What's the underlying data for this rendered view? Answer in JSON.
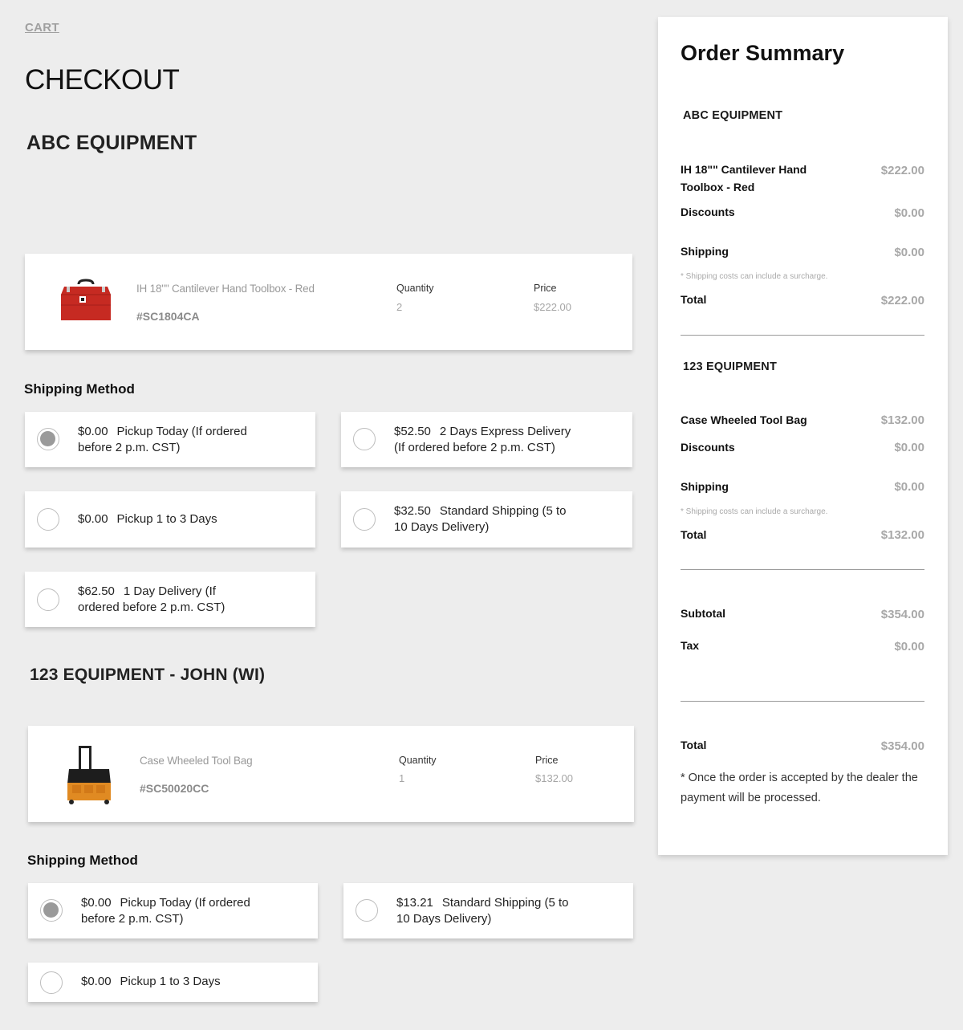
{
  "breadcrumb": {
    "cart_label": "CART"
  },
  "page_title": "CHECKOUT",
  "dealers": [
    {
      "name": "ABC EQUIPMENT",
      "product": {
        "name": "IH 18\"\" Cantilever Hand Toolbox - Red",
        "sku": "#SC1804CA",
        "quantity_label": "Quantity",
        "quantity": "2",
        "price_label": "Price",
        "price": "$222.00",
        "image": "red-toolbox-image"
      },
      "shipping_heading": "Shipping Method",
      "shipping_options": [
        {
          "price": "$0.00",
          "line1": "Pickup Today (If ordered",
          "line2": "before 2 p.m. CST)",
          "selected": true
        },
        {
          "price": "$52.50",
          "line1": "2 Days Express Delivery",
          "line2": "(If ordered before 2 p.m. CST)",
          "selected": false
        },
        {
          "price": "$0.00",
          "line1": "Pickup 1 to 3 Days",
          "line2": "",
          "selected": false
        },
        {
          "price": "$32.50",
          "line1": "Standard Shipping (5 to",
          "line2": "10 Days Delivery)",
          "selected": false
        },
        {
          "price": "$62.50",
          "line1": "1 Day Delivery (If",
          "line2": "ordered before 2 p.m. CST)",
          "selected": false
        }
      ]
    },
    {
      "name": "123 EQUIPMENT - JOHN (WI)",
      "product": {
        "name": "Case Wheeled Tool Bag",
        "sku": "#SC50020CC",
        "quantity_label": "Quantity",
        "quantity": "1",
        "price_label": "Price",
        "price": "$132.00",
        "image": "wheeled-tool-bag-image"
      },
      "shipping_heading": "Shipping Method",
      "shipping_options": [
        {
          "price": "$0.00",
          "line1": "Pickup Today (If ordered",
          "line2": "before 2 p.m. CST)",
          "selected": true
        },
        {
          "price": "$13.21",
          "line1": "Standard Shipping (5 to",
          "line2": "10 Days Delivery)",
          "selected": false
        },
        {
          "price": "$0.00",
          "line1": "Pickup 1 to 3 Days",
          "line2": "",
          "selected": false
        }
      ]
    }
  ],
  "summary": {
    "title": "Order Summary",
    "dealers": [
      {
        "name": "ABC EQUIPMENT",
        "item_name_line1": "IH 18\"\" Cantilever Hand",
        "item_name_line2": "Toolbox - Red",
        "item_price": "$222.00",
        "discounts_label": "Discounts",
        "discounts": "$0.00",
        "shipping_label": "Shipping",
        "shipping": "$0.00",
        "shipping_note": "* Shipping costs can include a surcharge.",
        "total_label": "Total",
        "total": "$222.00"
      },
      {
        "name": "123 EQUIPMENT",
        "item_name_line1": "Case Wheeled Tool Bag",
        "item_price": "$132.00",
        "discounts_label": "Discounts",
        "discounts": "$0.00",
        "shipping_label": "Shipping",
        "shipping": "$0.00",
        "shipping_note": "* Shipping costs can include a surcharge.",
        "total_label": "Total",
        "total": "$132.00"
      }
    ],
    "subtotal_label": "Subtotal",
    "subtotal": "$354.00",
    "tax_label": "Tax",
    "tax": "$0.00",
    "grand_total_label": "Total",
    "grand_total": "$354.00",
    "footnote": "* Once the order is accepted by the dealer the payment will be processed."
  },
  "colors": {
    "background": "#ededed",
    "card": "#ffffff",
    "radio_selected": "#9a9a9a",
    "muted_text": "#a8a8a8"
  }
}
